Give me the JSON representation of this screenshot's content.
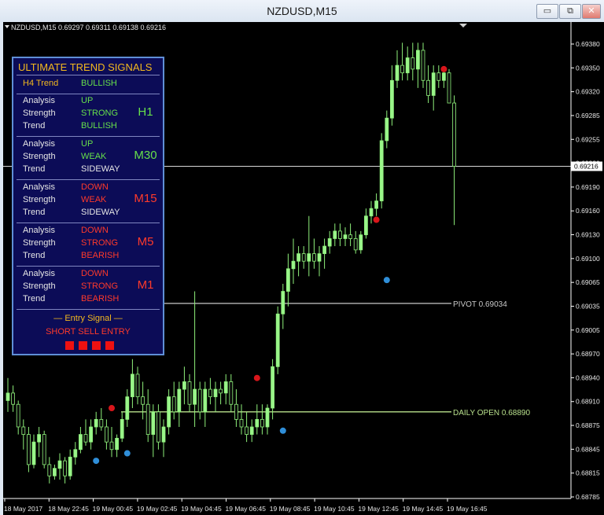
{
  "window": {
    "title": "NZDUSD,M15",
    "buttons": {
      "minimize": "▭",
      "restore": "⧉",
      "close": "✕"
    }
  },
  "chart": {
    "header": "NZDUSD,M15  0.69297 0.69311 0.69138 0.69216",
    "current_price": "0.69216",
    "colors": {
      "bull": "#9af58a",
      "bear": "#0a0a0a",
      "wick": "#8ef07a",
      "grid": "#d7d7d7",
      "axis": "#ffffff",
      "pivot": "#c8c8c8",
      "daily": "#b8e08c",
      "buy_dot": "#2f8ed8",
      "sell_dot": "#d8161b"
    },
    "y_ticks": [
      "0.69380",
      "0.69350",
      "0.69320",
      "0.69285",
      "0.69255",
      "0.69220",
      "0.69190",
      "0.69160",
      "0.69130",
      "0.69100",
      "0.69065",
      "0.69035",
      "0.69005",
      "0.68970",
      "0.68940",
      "0.68910",
      "0.68875",
      "0.68845",
      "0.68815",
      "0.68785"
    ],
    "x_ticks": [
      "18 May 2017",
      "18 May 22:45",
      "19 May 00:45",
      "19 May 02:45",
      "19 May 04:45",
      "19 May 06:45",
      "19 May 08:45",
      "19 May 10:45",
      "19 May 12:45",
      "19 May 14:45",
      "19 May 16:45"
    ],
    "levels": [
      {
        "label": "PIVOT 0.69034",
        "value": 0.69034
      },
      {
        "label": "DAILY OPEN 0.68890",
        "value": 0.6889
      }
    ]
  },
  "chart_data": {
    "type": "candlestick",
    "y_range": [
      0.68775,
      0.69395
    ],
    "candles": [
      [
        0.68905,
        0.68935,
        0.6889,
        0.68915
      ],
      [
        0.68915,
        0.68925,
        0.6889,
        0.689
      ],
      [
        0.689,
        0.68905,
        0.6886,
        0.6887
      ],
      [
        0.6887,
        0.6888,
        0.6884,
        0.6886
      ],
      [
        0.6886,
        0.6887,
        0.6881,
        0.6882
      ],
      [
        0.6882,
        0.6886,
        0.68815,
        0.6885
      ],
      [
        0.6885,
        0.6887,
        0.6883,
        0.6886
      ],
      [
        0.6886,
        0.68865,
        0.68815,
        0.6882
      ],
      [
        0.6882,
        0.6883,
        0.68795,
        0.68805
      ],
      [
        0.68805,
        0.6882,
        0.688,
        0.68815
      ],
      [
        0.68815,
        0.68835,
        0.688,
        0.68825
      ],
      [
        0.68825,
        0.6883,
        0.68795,
        0.68805
      ],
      [
        0.68805,
        0.6884,
        0.688,
        0.6883
      ],
      [
        0.6883,
        0.6885,
        0.6882,
        0.6884
      ],
      [
        0.6884,
        0.6887,
        0.68835,
        0.6886
      ],
      [
        0.6886,
        0.6888,
        0.68845,
        0.6885
      ],
      [
        0.6885,
        0.6888,
        0.6884,
        0.6887
      ],
      [
        0.6887,
        0.6889,
        0.6886,
        0.6888
      ],
      [
        0.6888,
        0.68895,
        0.68865,
        0.6887
      ],
      [
        0.6887,
        0.6888,
        0.6884,
        0.6885
      ],
      [
        0.6885,
        0.6887,
        0.6883,
        0.6884
      ],
      [
        0.6884,
        0.6886,
        0.6883,
        0.68855
      ],
      [
        0.68855,
        0.6889,
        0.6885,
        0.6888
      ],
      [
        0.6888,
        0.6892,
        0.6887,
        0.6891
      ],
      [
        0.6891,
        0.6896,
        0.68895,
        0.6894
      ],
      [
        0.6894,
        0.6895,
        0.689,
        0.6891
      ],
      [
        0.6891,
        0.6893,
        0.6888,
        0.689
      ],
      [
        0.689,
        0.6892,
        0.6885,
        0.6886
      ],
      [
        0.6886,
        0.689,
        0.6883,
        0.6889
      ],
      [
        0.6889,
        0.689,
        0.6884,
        0.6885
      ],
      [
        0.6885,
        0.6888,
        0.6883,
        0.6887
      ],
      [
        0.6887,
        0.6892,
        0.6886,
        0.6891
      ],
      [
        0.6891,
        0.6893,
        0.6888,
        0.6889
      ],
      [
        0.6889,
        0.6893,
        0.6887,
        0.6892
      ],
      [
        0.6892,
        0.6895,
        0.689,
        0.6893
      ],
      [
        0.6893,
        0.6894,
        0.6889,
        0.689
      ],
      [
        0.689,
        0.6905,
        0.6887,
        0.6892
      ],
      [
        0.6892,
        0.6893,
        0.6888,
        0.6889
      ],
      [
        0.6889,
        0.6893,
        0.6887,
        0.6892
      ],
      [
        0.6892,
        0.68935,
        0.689,
        0.6891
      ],
      [
        0.6891,
        0.6893,
        0.6889,
        0.6892
      ],
      [
        0.6892,
        0.6893,
        0.689,
        0.68915
      ],
      [
        0.68915,
        0.6894,
        0.689,
        0.6893
      ],
      [
        0.6893,
        0.6894,
        0.6889,
        0.689
      ],
      [
        0.689,
        0.6892,
        0.6887,
        0.6888
      ],
      [
        0.6888,
        0.689,
        0.6886,
        0.6887
      ],
      [
        0.6887,
        0.6889,
        0.6885,
        0.6886
      ],
      [
        0.6886,
        0.6888,
        0.6885,
        0.6887
      ],
      [
        0.6887,
        0.689,
        0.6886,
        0.6888
      ],
      [
        0.6888,
        0.689,
        0.6886,
        0.6887
      ],
      [
        0.6887,
        0.689,
        0.6886,
        0.68895
      ],
      [
        0.68895,
        0.6896,
        0.6888,
        0.6895
      ],
      [
        0.6895,
        0.6903,
        0.6894,
        0.6902
      ],
      [
        0.6902,
        0.6906,
        0.69,
        0.6905
      ],
      [
        0.6905,
        0.691,
        0.6903,
        0.6908
      ],
      [
        0.6908,
        0.6912,
        0.6906,
        0.6909
      ],
      [
        0.6909,
        0.6911,
        0.6907,
        0.691
      ],
      [
        0.691,
        0.6911,
        0.6908,
        0.6909
      ],
      [
        0.6909,
        0.6915,
        0.6907,
        0.691
      ],
      [
        0.691,
        0.6912,
        0.6908,
        0.6909
      ],
      [
        0.6909,
        0.6911,
        0.6907,
        0.691
      ],
      [
        0.691,
        0.6912,
        0.6908,
        0.6911
      ],
      [
        0.6911,
        0.6913,
        0.691,
        0.6912
      ],
      [
        0.6912,
        0.6914,
        0.6911,
        0.6913
      ],
      [
        0.6913,
        0.6914,
        0.6911,
        0.6912
      ],
      [
        0.6912,
        0.69135,
        0.6911,
        0.69125
      ],
      [
        0.69125,
        0.6914,
        0.6911,
        0.6912
      ],
      [
        0.6912,
        0.6913,
        0.691,
        0.69105
      ],
      [
        0.69105,
        0.6913,
        0.691,
        0.69125
      ],
      [
        0.69125,
        0.6916,
        0.6912,
        0.6915
      ],
      [
        0.6915,
        0.6917,
        0.6914,
        0.6916
      ],
      [
        0.6916,
        0.6918,
        0.6915,
        0.6917
      ],
      [
        0.6917,
        0.6926,
        0.6916,
        0.6925
      ],
      [
        0.6925,
        0.6929,
        0.6924,
        0.6928
      ],
      [
        0.6928,
        0.6935,
        0.6927,
        0.6933
      ],
      [
        0.6933,
        0.6937,
        0.6932,
        0.6935
      ],
      [
        0.6935,
        0.6938,
        0.6933,
        0.6934
      ],
      [
        0.6934,
        0.69375,
        0.6933,
        0.6936
      ],
      [
        0.6936,
        0.6938,
        0.6933,
        0.69345
      ],
      [
        0.69345,
        0.6938,
        0.6932,
        0.6937
      ],
      [
        0.6937,
        0.6938,
        0.6932,
        0.6933
      ],
      [
        0.6933,
        0.6935,
        0.693,
        0.6931
      ],
      [
        0.6931,
        0.6935,
        0.6929,
        0.6934
      ],
      [
        0.6934,
        0.6935,
        0.6932,
        0.6933
      ],
      [
        0.6933,
        0.69345,
        0.6932,
        0.6934
      ],
      [
        0.6934,
        0.69345,
        0.693,
        0.693
      ],
      [
        0.693,
        0.6931,
        0.69138,
        0.69216
      ]
    ],
    "sell_signals": [
      [
        20,
        0.68895
      ],
      [
        48,
        0.68935
      ],
      [
        71,
        0.69145
      ],
      [
        84,
        0.69345
      ]
    ],
    "buy_signals": [
      [
        17,
        0.68825
      ],
      [
        23,
        0.68835
      ],
      [
        53,
        0.68865
      ],
      [
        73,
        0.69065
      ]
    ]
  },
  "panel": {
    "title": "ULTIMATE TREND SIGNALS",
    "h4": {
      "label": "H4 Trend",
      "value": "BULLISH",
      "color": "#66e04a"
    },
    "row_labels": {
      "analysis": "Analysis",
      "strength": "Strength",
      "trend": "Trend"
    },
    "timeframes": [
      {
        "tf": "H1",
        "tf_color": "#66e04a",
        "analysis": "UP",
        "a_color": "#66e04a",
        "strength": "STRONG",
        "s_color": "#66e04a",
        "trend": "BULLISH",
        "t_color": "#66e04a"
      },
      {
        "tf": "M30",
        "tf_color": "#66e04a",
        "analysis": "UP",
        "a_color": "#66e04a",
        "strength": "WEAK",
        "s_color": "#66e04a",
        "trend": "SIDEWAY",
        "t_color": "#e6e6e6"
      },
      {
        "tf": "M15",
        "tf_color": "#ff3a2a",
        "analysis": "DOWN",
        "a_color": "#ff3a2a",
        "strength": "WEAK",
        "s_color": "#ff3a2a",
        "trend": "SIDEWAY",
        "t_color": "#e6e6e6"
      },
      {
        "tf": "M5",
        "tf_color": "#ff3a2a",
        "analysis": "DOWN",
        "a_color": "#ff3a2a",
        "strength": "STRONG",
        "s_color": "#ff3a2a",
        "trend": "BEARISH",
        "t_color": "#ff3a2a"
      },
      {
        "tf": "M1",
        "tf_color": "#ff3a2a",
        "analysis": "DOWN",
        "a_color": "#ff3a2a",
        "strength": "STRONG",
        "s_color": "#ff3a2a",
        "trend": "BEARISH",
        "t_color": "#ff3a2a"
      }
    ],
    "entry_label": "— Entry Signal —",
    "entry_signal": "SHORT SELL ENTRY",
    "signal_boxes": 4,
    "title_color": "#f2b81e",
    "entry_color": "#ff3a2a"
  }
}
